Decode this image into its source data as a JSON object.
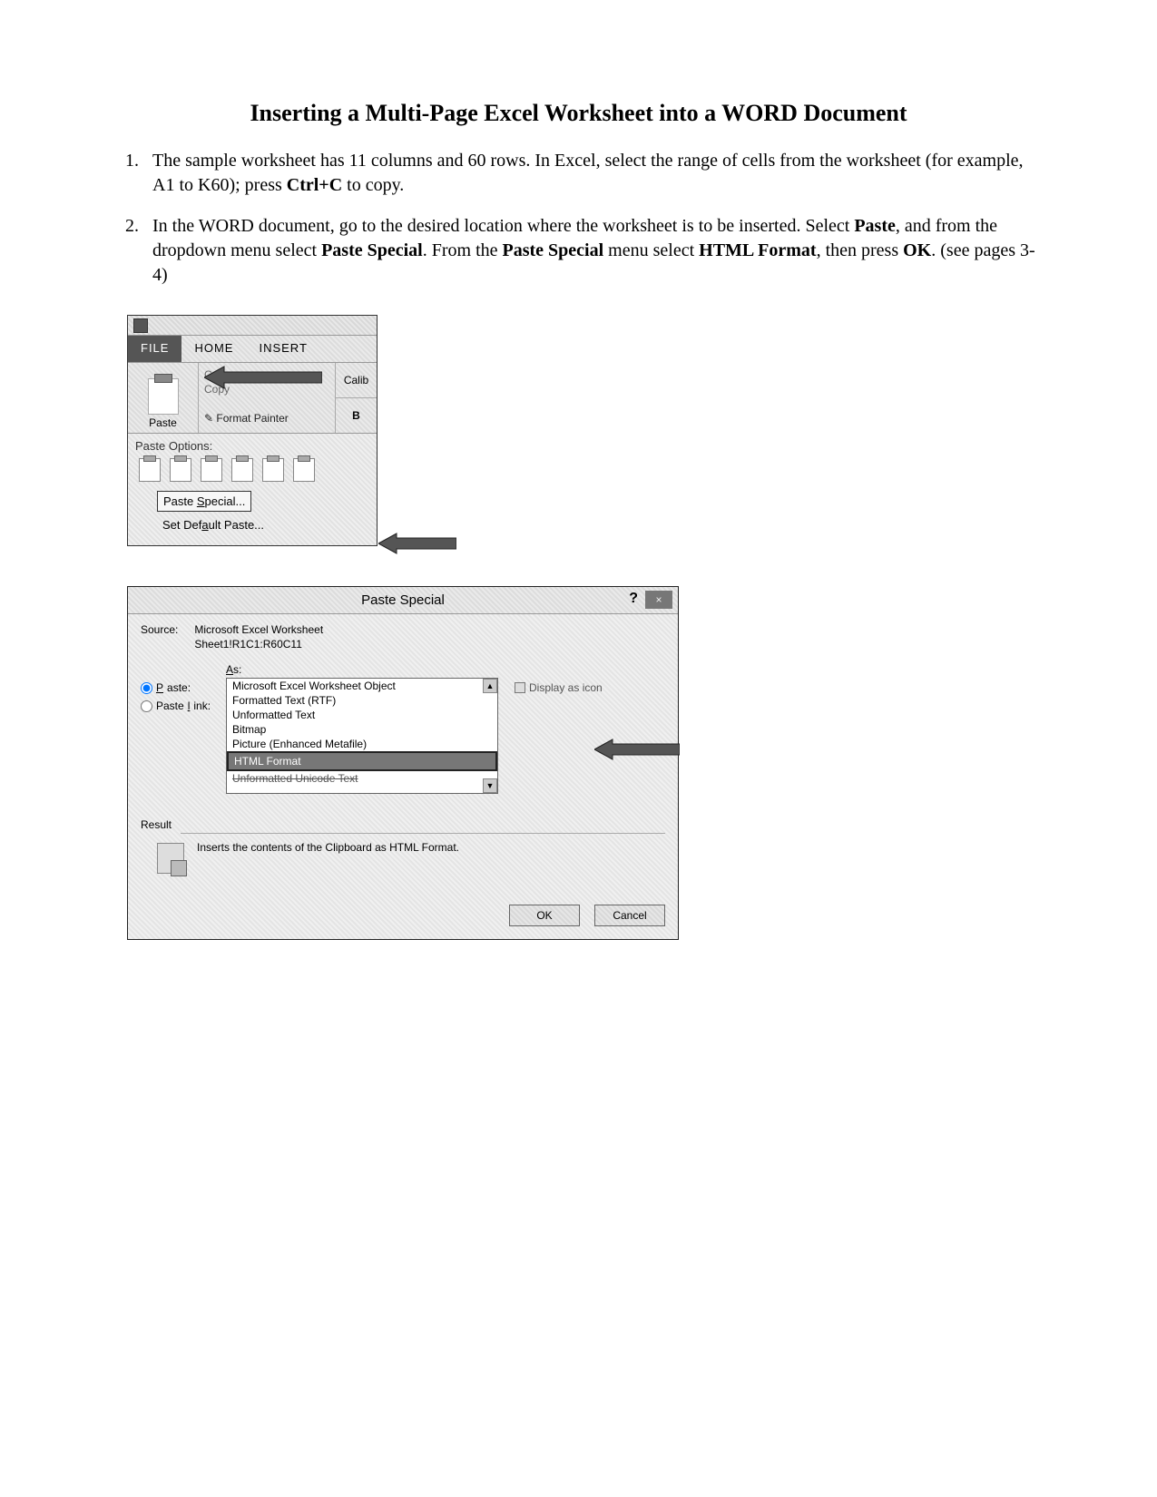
{
  "title": "Inserting a Multi-Page Excel Worksheet into a WORD Document",
  "steps": {
    "s1a": "The sample worksheet has 11 columns and 60 rows. In Excel, select the range of cells from the worksheet (for example, A1 to K60); press ",
    "s1b": "Ctrl+C",
    "s1c": " to copy.",
    "s2a": "In the WORD document, go to the desired location where the worksheet is to be inserted. Select ",
    "s2b": "Paste",
    "s2c": ", and from the dropdown menu select ",
    "s2d": "Paste Special",
    "s2e": ". From the ",
    "s2f": "Paste Special",
    "s2g": " menu select ",
    "s2h": "HTML Format",
    "s2i": ", then press ",
    "s2j": "OK",
    "s2k": ". (see pages 3-4)"
  },
  "ribbon": {
    "tab_file": "FILE",
    "tab_home": "HOME",
    "tab_insert": "INSERT",
    "paste_label": "Paste",
    "cut": "Cut",
    "copy": "Copy",
    "fmt_painter": "Format Painter",
    "font_name": "Calib",
    "bold": "B",
    "dd_title": "Paste Options:",
    "paste_special": "Paste Special...",
    "set_default": "Set Default Paste..."
  },
  "dialog": {
    "title": "Paste Special",
    "help": "?",
    "close": "×",
    "source_lbl": "Source:",
    "source_val1": "Microsoft Excel Worksheet",
    "source_val2": "Sheet1!R1C1:R60C11",
    "as_lbl": "As:",
    "radio_paste": "Paste:",
    "radio_link": "Paste link:",
    "opts": {
      "o1": "Microsoft Excel Worksheet Object",
      "o2": "Formatted Text (RTF)",
      "o3": "Unformatted Text",
      "o4": "Bitmap",
      "o5": "Picture (Enhanced Metafile)",
      "o6": "HTML Format",
      "o7": "Unformatted Unicode Text"
    },
    "display_icon": "Display as icon",
    "result_lbl": "Result",
    "result_text": "Inserts the contents of the Clipboard as HTML Format.",
    "ok": "OK",
    "cancel": "Cancel"
  }
}
